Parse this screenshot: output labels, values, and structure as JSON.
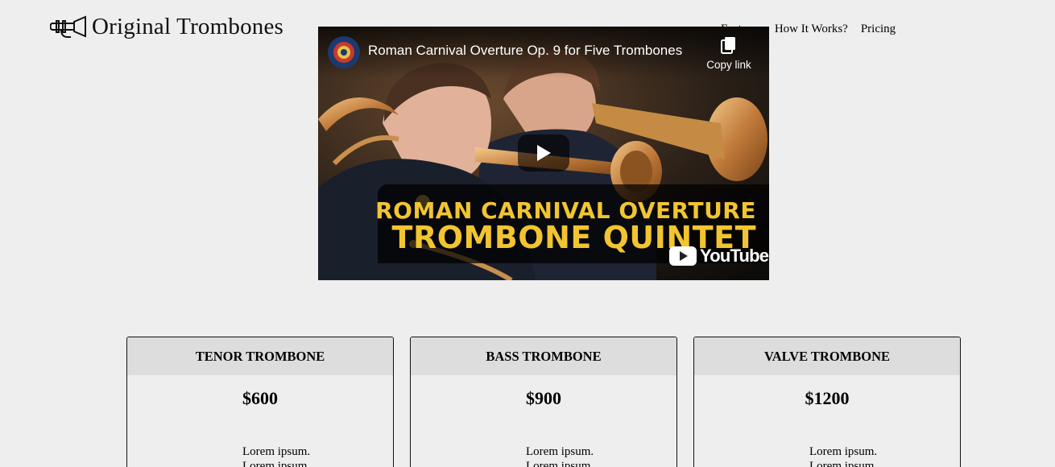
{
  "header": {
    "brand": "Original Trombones",
    "logo_icon": "trombone-logo-icon",
    "nav": [
      {
        "label": "Features"
      },
      {
        "label": "How It Works?"
      },
      {
        "label": "Pricing"
      }
    ]
  },
  "video": {
    "title": "Roman Carnival Overture Op. 9 for Five Trombones",
    "copy_link_label": "Copy link",
    "banner_line1": "ROMAN CARNIVAL OVERTURE",
    "banner_line2": "TROMBONE QUINTET",
    "platform": "YouTube",
    "icons": [
      "channel-avatar-icon",
      "copy-link-icon",
      "play-icon",
      "youtube-logo-icon"
    ]
  },
  "pricing": [
    {
      "name": "TENOR TROMBONE",
      "price": "$600",
      "features": [
        "Lorem ipsum.",
        "Lorem ipsum."
      ]
    },
    {
      "name": "BASS TROMBONE",
      "price": "$900",
      "features": [
        "Lorem ipsum.",
        "Lorem ipsum."
      ]
    },
    {
      "name": "VALVE TROMBONE",
      "price": "$1200",
      "features": [
        "Lorem ipsum.",
        "Lorem ipsum."
      ]
    }
  ],
  "colors": {
    "page_bg": "#eeeeee",
    "card_header_bg": "#dddddd",
    "banner_text": "#f2c530",
    "youtube_red": "#ff0000"
  }
}
